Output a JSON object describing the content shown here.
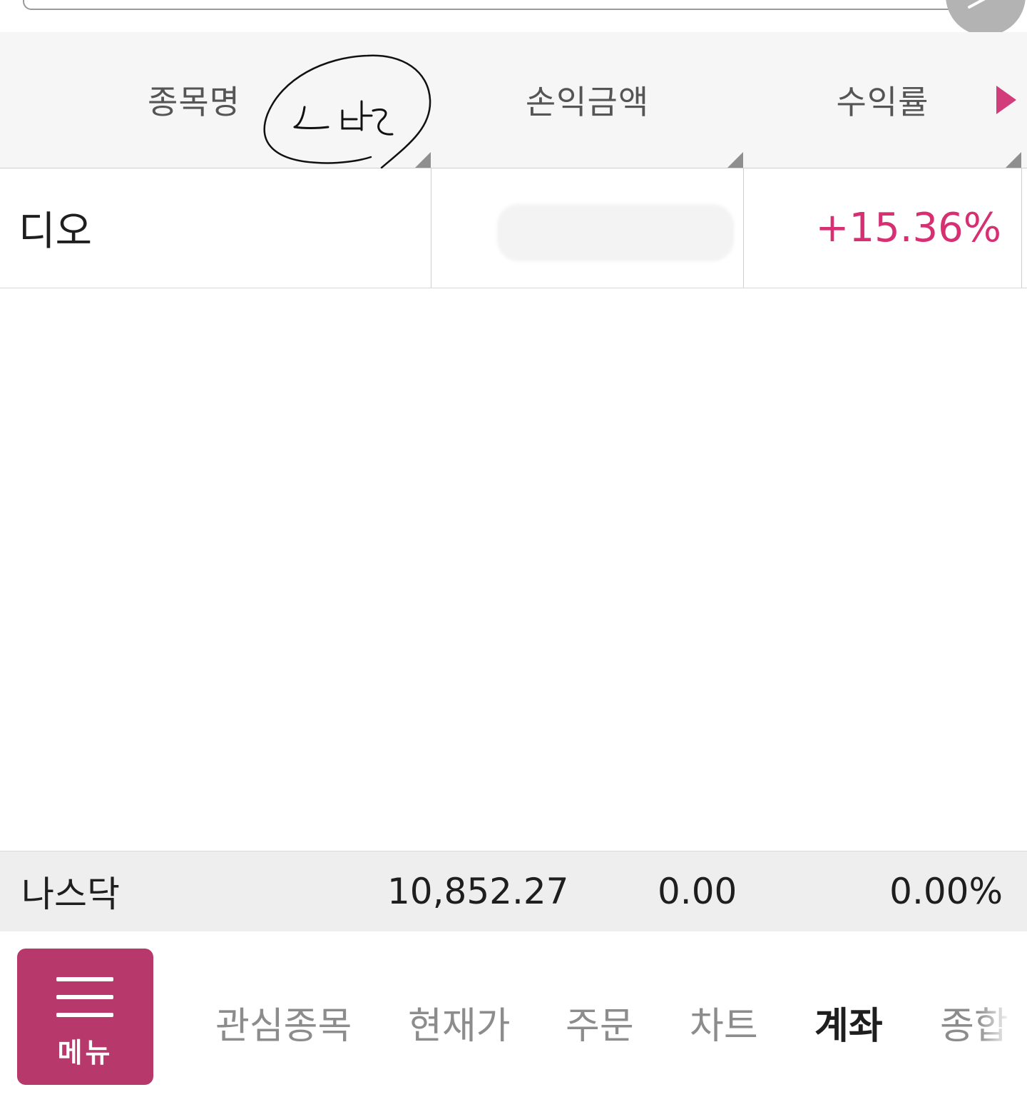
{
  "table": {
    "headers": [
      "종목명",
      "손익금액",
      "수익률"
    ],
    "rows": [
      {
        "name": "디오",
        "profit_amount": "",
        "return_rate": "+15.36%"
      }
    ]
  },
  "index_ticker": {
    "name": "나스닥",
    "value": "10,852.27",
    "change": "0.00",
    "change_rate": "0.00%"
  },
  "bottom_nav": {
    "menu_label": "메뉴",
    "items": [
      "관심종목",
      "현재가",
      "주문",
      "차트",
      "계좌",
      "종합"
    ],
    "active": "계좌"
  },
  "colors": {
    "accent": "#b7386b",
    "positive": "#d62f72",
    "header_bg": "#f6f6f6",
    "index_bg": "#eeeeee"
  },
  "icons": [
    "edit-icon",
    "next-columns-icon",
    "hamburger-icon",
    "sort-indicator-icon"
  ]
}
